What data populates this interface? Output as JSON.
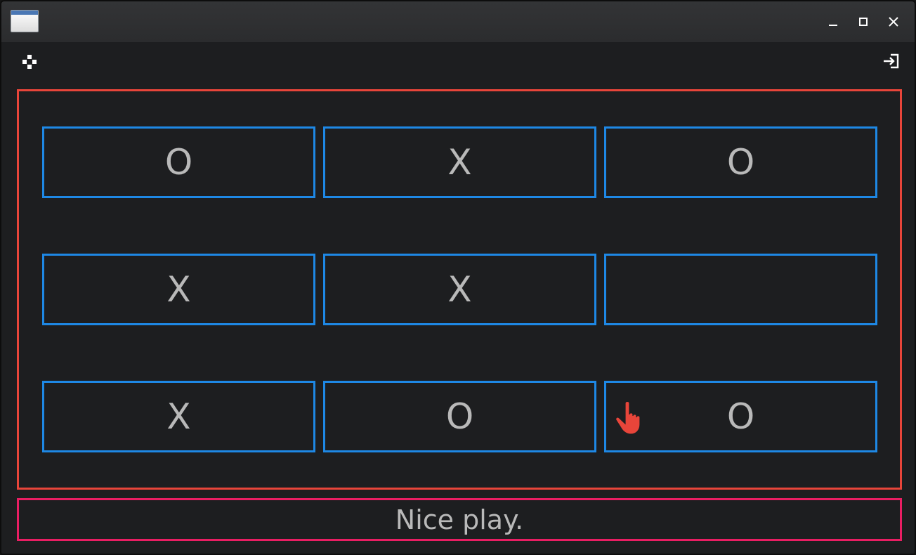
{
  "window": {
    "controls": {
      "minimize_icon": "minimize-icon",
      "maximize_icon": "maximize-icon",
      "close_icon": "close-icon"
    }
  },
  "toolbar": {
    "left_icon": "gamepad-icon",
    "right_icon": "exit-icon"
  },
  "board": {
    "cells": [
      "O",
      "X",
      "O",
      "X",
      "X",
      "",
      "X",
      "O",
      "O"
    ]
  },
  "status": {
    "text": "Nice play."
  },
  "colors": {
    "board_border": "#e8453a",
    "cell_border": "#1e88e5",
    "status_border": "#e91e63",
    "text": "#b9b9b9",
    "background": "#1d1e20",
    "cursor": "#e8453a"
  }
}
